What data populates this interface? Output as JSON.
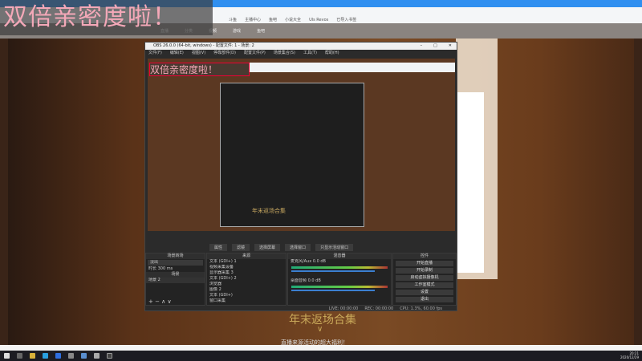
{
  "overlay": {
    "text": "双倍亲密度啦！"
  },
  "browser": {
    "bookmarks": [
      "斗鱼",
      "主播中心",
      "鱼吧",
      "小说大全",
      "Uls Revos",
      "已导入书签"
    ],
    "nav": [
      "直播",
      "分类",
      "视频",
      "游戏",
      "鱼吧"
    ]
  },
  "obs": {
    "title": "OBS 26.0.0 (64-bit, windows) - 配置文件: 1 - 场景: 2",
    "menu": [
      "文件(F)",
      "编辑(E)",
      "视图(V)",
      "停靠部件(D)",
      "配置文件(P)",
      "场景集合(S)",
      "工具(T)",
      "帮助(H)"
    ],
    "controls_row": [
      "属性",
      "滤镜",
      "选择屏幕",
      "选择窗口",
      "只显示活动窗口"
    ],
    "docks": {
      "transitions": {
        "header": "场景转场",
        "transition": "淡出",
        "duration_label": "时长",
        "duration": "300 ms"
      },
      "scenes": {
        "header": "场景",
        "items": [
          "场景 2"
        ]
      },
      "sources": {
        "header": "来源",
        "items": [
          "文本 (GDI+) 1",
          "视频采集设备",
          "显示器采集 3",
          "文本 (GDI+) 2",
          "浏览器",
          "图像 2",
          "文本 (GDI+)",
          "窗口采集"
        ]
      },
      "mixer": {
        "header": "混音器",
        "channels": [
          {
            "name": "麦克风/Aux",
            "level": "0.0 dB"
          },
          {
            "name": "桌面音频",
            "level": "0.0 dB"
          }
        ]
      },
      "controls": {
        "header": "控件",
        "buttons": [
          "开始直播",
          "开始录制",
          "启动虚拟摄像机",
          "工作室模式",
          "设置",
          "退出"
        ]
      }
    },
    "status": [
      "LIVE: 00:00:00",
      "REC: 00:00:00",
      "CPU: 1.3%, 60.00 fps"
    ]
  },
  "stream": {
    "banner": "年末返场合集",
    "subtitle": "直播来源活动的超大福利！"
  },
  "clock": {
    "time": "20:21",
    "date": "2020/12/29"
  }
}
